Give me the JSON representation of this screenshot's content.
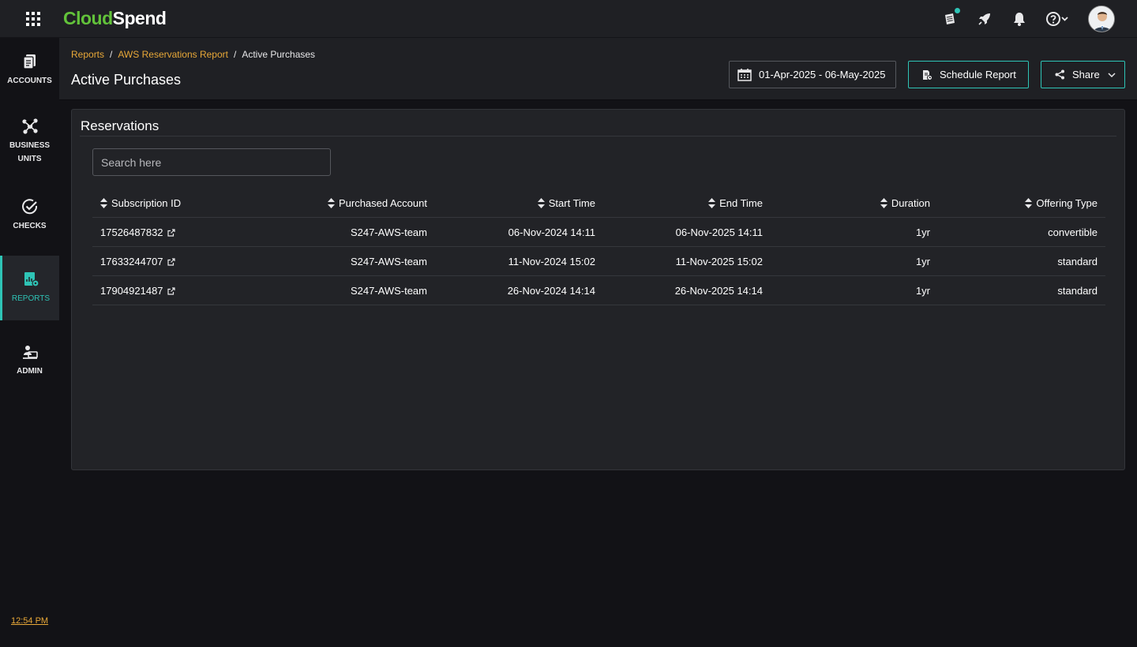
{
  "app": {
    "brand_part1": "Cloud",
    "brand_part2": "Spend",
    "accent_color": "#2ec4b6",
    "brand_color": "#62c23a",
    "link_color": "#e8a838"
  },
  "topbar": {
    "icons": [
      "apps-grid-icon",
      "whats-new-icon",
      "rocket-icon",
      "bell-icon",
      "help-icon",
      "avatar"
    ]
  },
  "sidebar": {
    "items": [
      {
        "label": "ACCOUNTS",
        "icon": "accounts-icon"
      },
      {
        "label_line1": "BUSINESS",
        "label_line2": "UNITS",
        "icon": "business-units-icon"
      },
      {
        "label": "CHECKS",
        "icon": "checks-icon"
      },
      {
        "label": "REPORTS",
        "icon": "reports-icon",
        "active": true
      },
      {
        "label": "ADMIN",
        "icon": "admin-icon"
      }
    ],
    "time": "12:54 PM"
  },
  "breadcrumb": {
    "items": [
      "Reports",
      "AWS Reservations Report"
    ],
    "separator": "/",
    "current": "Active Purchases"
  },
  "page": {
    "title": "Active Purchases",
    "date_range": "01-Apr-2025 - 06-May-2025",
    "schedule_label": "Schedule Report",
    "share_label": "Share"
  },
  "card": {
    "title": "Reservations",
    "search_placeholder": "Search here"
  },
  "table": {
    "columns": [
      "Subscription ID",
      "Purchased Account",
      "Start Time",
      "End Time",
      "Duration",
      "Offering Type"
    ],
    "rows": [
      [
        "17526487832",
        "S247-AWS-team",
        "06-Nov-2024 14:11",
        "06-Nov-2025 14:11",
        "1yr",
        "convertible"
      ],
      [
        "17633244707",
        "S247-AWS-team",
        "11-Nov-2024 15:02",
        "11-Nov-2025 15:02",
        "1yr",
        "standard"
      ],
      [
        "17904921487",
        "S247-AWS-team",
        "26-Nov-2024 14:14",
        "26-Nov-2025 14:14",
        "1yr",
        "standard"
      ]
    ]
  }
}
